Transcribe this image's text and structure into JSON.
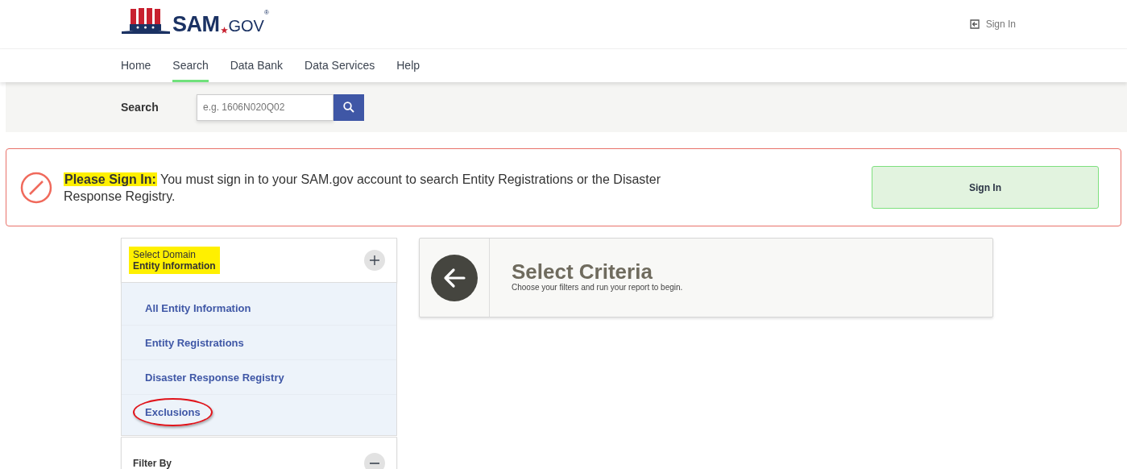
{
  "header": {
    "logo": {
      "name": "SAM",
      "suffix": "GOV",
      "mark": "®"
    },
    "sign_in": "Sign In"
  },
  "nav": [
    {
      "label": "Home",
      "selected": false
    },
    {
      "label": "Search",
      "selected": true
    },
    {
      "label": "Data Bank",
      "selected": false
    },
    {
      "label": "Data Services",
      "selected": false
    },
    {
      "label": "Help",
      "selected": false
    }
  ],
  "search": {
    "label": "Search",
    "placeholder": "e.g. 1606N020Q02"
  },
  "alert": {
    "title": "Please Sign In:",
    "title_highlighted": true,
    "message": "You must sign in to your SAM.gov account to search Entity Registrations or the Disaster Response Registry.",
    "button": "Sign In"
  },
  "domain_panel": {
    "label": "Select Domain",
    "value": "Entity Information",
    "highlighted": true,
    "items": [
      {
        "label": "All Entity Information",
        "circled": false
      },
      {
        "label": "Entity Registrations",
        "circled": false
      },
      {
        "label": "Disaster Response Registry",
        "circled": false
      },
      {
        "label": "Exclusions",
        "circled": true
      }
    ]
  },
  "filter_panel": {
    "label": "Filter By",
    "expanded": true
  },
  "criteria": {
    "title": "Select Criteria",
    "subtitle": "Choose your filters and run your report to begin."
  }
}
